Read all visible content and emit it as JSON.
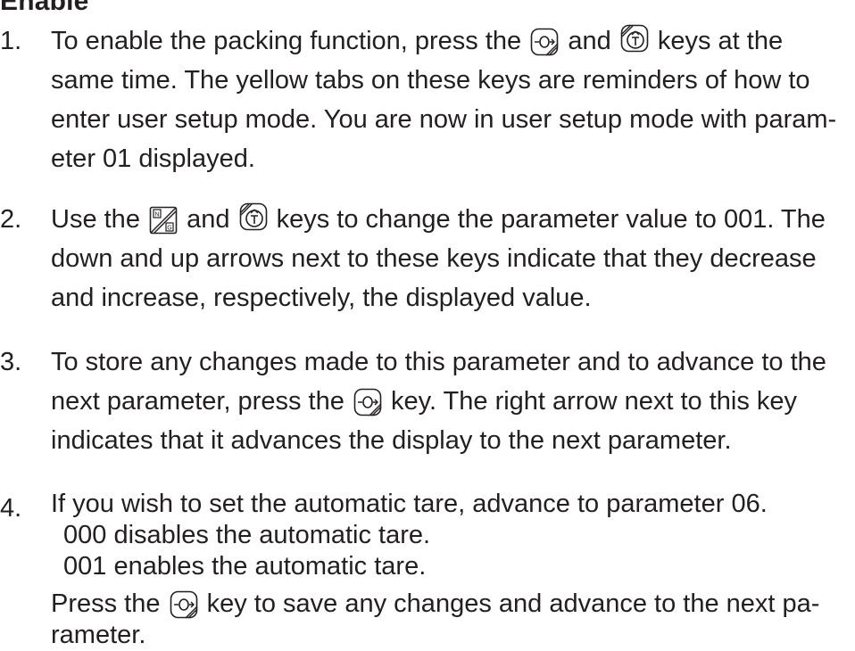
{
  "heading": "Enable",
  "steps": [
    {
      "number": "1.",
      "lines": [
        {
          "a": "To enable the packing function, press the",
          "b": "and",
          "c": "keys at the"
        },
        {
          "text": "same time.  The yellow tabs on these keys are reminders of how to"
        },
        {
          "text": "enter user setup mode.  You are now in user setup mode with param-"
        },
        {
          "text": "eter 01 displayed."
        }
      ],
      "icons": [
        "zero-key-icon",
        "tare-key-icon"
      ]
    },
    {
      "number": "2.",
      "lines": [
        {
          "a": "Use the",
          "b": "and",
          "c": "keys to change the parameter value to 001.  The"
        },
        {
          "text": "down and up arrows next to these keys indicate that they decrease"
        },
        {
          "text": "and increase, respectively, the displayed value."
        }
      ],
      "icons": [
        "net-gross-key-icon",
        "tare-key-icon"
      ]
    },
    {
      "number": "3.",
      "lines": [
        {
          "text": "To store any changes made to this parameter and to advance to the"
        },
        {
          "a": "next parameter, press the",
          "c": "key.  The right arrow next to this key"
        },
        {
          "text": "indicates that it advances the display to the next parameter."
        }
      ],
      "icons": [
        "zero-key-icon"
      ]
    },
    {
      "number": "4.",
      "lines": [
        {
          "text": "If you wish to set the automatic tare, advance to parameter 06."
        },
        {
          "text": "000 disables the automatic tare."
        },
        {
          "text": "001 enables the automatic tare."
        },
        {
          "a": "Press the",
          "c": "key to save any changes and advance to the next pa-"
        },
        {
          "text": "rameter."
        }
      ],
      "icons": [
        "zero-key-icon"
      ]
    }
  ]
}
